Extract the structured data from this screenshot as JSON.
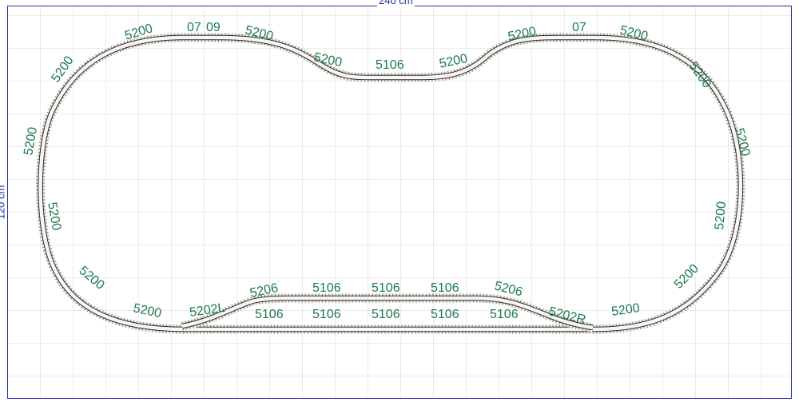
{
  "layout": {
    "width_label": "240 cm",
    "height_label": "120 cm",
    "colors": {
      "border": "#1f2f9f",
      "grid": "#d7d7d7",
      "rail": "#2b2b2b",
      "tie": "#8c8c8c",
      "label": "#1d7a4c"
    }
  },
  "track_labels": [
    {
      "id": "top-left-1",
      "text": "5200"
    },
    {
      "id": "top-07-left",
      "text": "07"
    },
    {
      "id": "top-09",
      "text": "09"
    },
    {
      "id": "top-5200-b",
      "text": "5200"
    },
    {
      "id": "top-5200-c",
      "text": "5200"
    },
    {
      "id": "top-5106",
      "text": "5106"
    },
    {
      "id": "top-5200-d",
      "text": "5200"
    },
    {
      "id": "top-5200-e",
      "text": "5200"
    },
    {
      "id": "top-07-right",
      "text": "07"
    },
    {
      "id": "top-right-1",
      "text": "5200"
    },
    {
      "id": "right-1",
      "text": "5200"
    },
    {
      "id": "right-2",
      "text": "5200"
    },
    {
      "id": "right-3",
      "text": "5200"
    },
    {
      "id": "right-4",
      "text": "5200"
    },
    {
      "id": "bottom-right",
      "text": "5200"
    },
    {
      "id": "switch-right",
      "text": "5202R"
    },
    {
      "id": "bottom-left",
      "text": "5200"
    },
    {
      "id": "switch-left",
      "text": "5202L"
    },
    {
      "id": "left-1",
      "text": "5200"
    },
    {
      "id": "left-2",
      "text": "5200"
    },
    {
      "id": "left-3",
      "text": "5200"
    },
    {
      "id": "left-4",
      "text": "5200"
    },
    {
      "id": "siding-5206-left",
      "text": "5206"
    },
    {
      "id": "siding-5206-right",
      "text": "5206"
    },
    {
      "id": "siding-5106-1",
      "text": "5106"
    },
    {
      "id": "siding-5106-2",
      "text": "5106"
    },
    {
      "id": "siding-5106-3",
      "text": "5106"
    },
    {
      "id": "main-5106-1",
      "text": "5106"
    },
    {
      "id": "main-5106-2",
      "text": "5106"
    },
    {
      "id": "main-5106-3",
      "text": "5106"
    },
    {
      "id": "main-5106-4",
      "text": "5106"
    },
    {
      "id": "main-5106-5",
      "text": "5106"
    }
  ]
}
